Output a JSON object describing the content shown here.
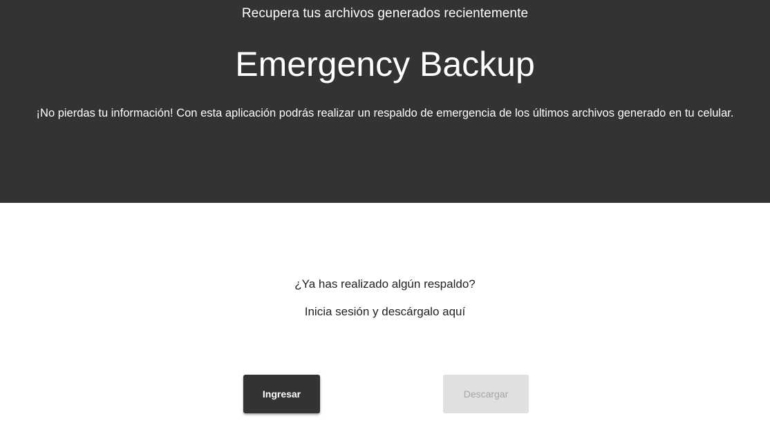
{
  "hero": {
    "kicker": "Recupera tus archivos generados recientemente",
    "title": "Emergency Backup",
    "description": "¡No pierdas tu información! Con esta aplicación podrás realizar un respaldo de emergencia de los últimos archivos generado en tu celular."
  },
  "content": {
    "question": "¿Ya has realizado algún respaldo?",
    "hint": "Inicia sesión y descárgalo aquí"
  },
  "actions": {
    "login_label": "Ingresar",
    "download_label": "Descargar"
  },
  "colors": {
    "hero_background": "#333333",
    "primary_button": "#333333",
    "disabled_button": "#e0e0e0",
    "disabled_text": "#a6a6a6"
  }
}
